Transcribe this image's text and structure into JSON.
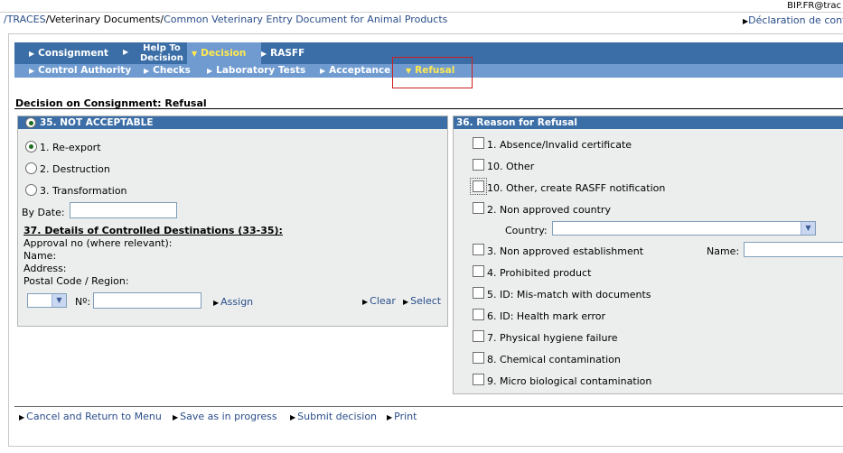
{
  "header": {
    "user": "BIP.FR@trac",
    "breadcrumb": [
      "/TRACES",
      "/Veterinary Documents/",
      "Common Veterinary Entry Document for Animal Products"
    ],
    "declaration_link": "Déclaration de conf"
  },
  "nav_primary": [
    {
      "label": "Consignment"
    },
    {
      "label_line1": "Help To",
      "label_line2": "Decision"
    },
    {
      "label": "Decision"
    },
    {
      "label": "RASFF"
    }
  ],
  "nav_secondary": [
    {
      "label": "Control Authority"
    },
    {
      "label": "Checks"
    },
    {
      "label": "Laboratory Tests"
    },
    {
      "label": "Acceptance"
    },
    {
      "label": "Refusal"
    }
  ],
  "section_title": "Decision on Consignment: Refusal",
  "left_panel": {
    "header": "35. NOT ACCEPTABLE",
    "options": [
      "1. Re-export",
      "2. Destruction",
      "3. Transformation"
    ],
    "selected_option": "1. Re-export",
    "by_date_label": "By Date:",
    "by_date_value": "",
    "destinations_title": "37. Details of Controlled Destinations (33-35):",
    "fields": [
      "Approval no (where relevant):",
      "Name:",
      "Address:",
      "Postal Code / Region:"
    ],
    "no_label": "Nº:",
    "assign": "Assign",
    "clear": "Clear",
    "select": "Select"
  },
  "right_panel": {
    "header": "36. Reason for Refusal",
    "reasons": [
      "1. Absence/Invalid certificate",
      "10. Other",
      "10. Other, create RASFF notification",
      "2. Non approved country",
      "3. Non approved establishment",
      "4. Prohibited product",
      "5. ID: Mis-match with documents",
      "6. ID: Health mark error",
      "7. Physical hygiene failure",
      "8. Chemical contamination",
      "9. Micro biological contamination"
    ],
    "country_label": "Country:",
    "name_label": "Name:"
  },
  "footer": [
    "Cancel and Return to Menu",
    "Save as in progress",
    "Submit decision",
    "Print"
  ]
}
